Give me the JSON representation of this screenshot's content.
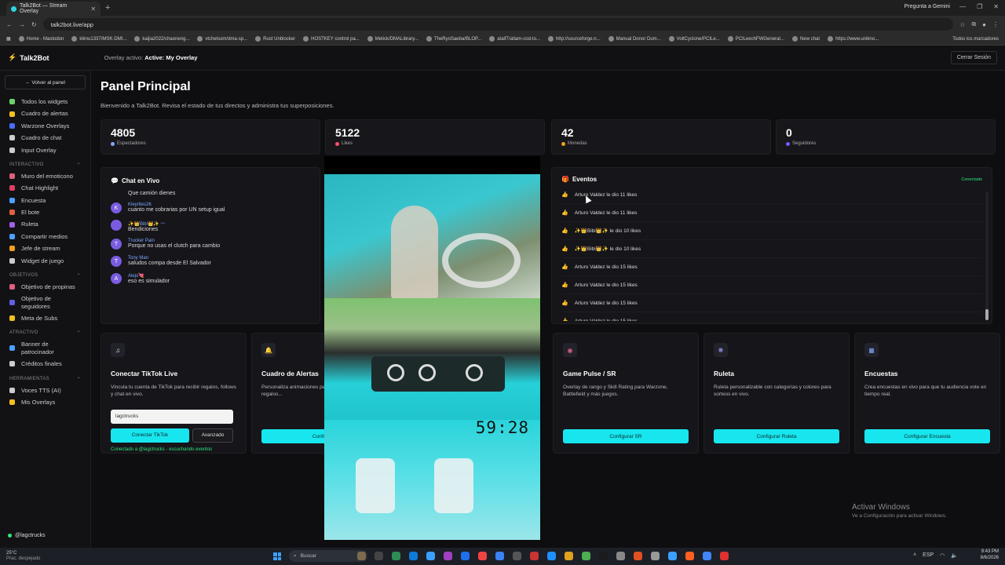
{
  "browser": {
    "tab_title": "Talk2Bot — Stream Overlay",
    "gemini": "Pregunta a Gemini",
    "url": "talk2bot.live/app",
    "bookmarks": [
      "Home - Mastodon",
      "klimu1337/MSK-DMI...",
      "kaijia2022/chaoneng...",
      "vtchelsom/dma-sp...",
      "Rust Unblocker",
      "HOSTKEY control pa...",
      "Metick/DMALibrary...",
      "TheRyoSaeba/BLOP...",
      "ataif7/atlam-cod-to...",
      "http://sourceforge.n...",
      "Manual Donor Dum...",
      "VoltCyclone/PCILe...",
      "PCILeechFWGenerat...",
      "New chat",
      "https://www.unikno..."
    ],
    "bookmarks_all": "Todos los marcadores"
  },
  "header": {
    "logo": "Talk2Bot",
    "overlay_label": "Overlay activo:",
    "overlay_name": "Active: My Overlay",
    "logout": "Cerrar Sesión"
  },
  "sidebar": {
    "back": "← Volver al panel",
    "top_items": [
      {
        "label": "Todos los widgets",
        "color": "#6bd26b"
      },
      {
        "label": "Cuadro de alertas",
        "color": "#f0c020"
      },
      {
        "label": "Warzone Overlays",
        "color": "#4a6cff"
      },
      {
        "label": "Cuadro de chat",
        "color": "#cccccc"
      },
      {
        "label": "Input Overlay",
        "color": "#cccccc"
      }
    ],
    "sections": [
      {
        "title": "INTERACTIVO",
        "items": [
          {
            "label": "Muro del emoticono",
            "color": "#e06080"
          },
          {
            "label": "Chat Highlight",
            "color": "#e04060"
          },
          {
            "label": "Encuesta",
            "color": "#4aa0ff"
          },
          {
            "label": "El bote",
            "color": "#e06040"
          },
          {
            "label": "Ruleta",
            "color": "#a060e0"
          },
          {
            "label": "Compartir medios",
            "color": "#4aa0ff"
          },
          {
            "label": "Jefe de stream",
            "color": "#f0a020"
          },
          {
            "label": "Widget de juego",
            "color": "#cccccc"
          }
        ]
      },
      {
        "title": "OBJETIVOS",
        "items": [
          {
            "label": "Objetivo de propinas",
            "color": "#e06080"
          },
          {
            "label": "Objetivo de seguidores",
            "color": "#6060e0"
          },
          {
            "label": "Meta de Subs",
            "color": "#f0c020"
          }
        ]
      },
      {
        "title": "ATRACTIVO",
        "items": [
          {
            "label": "Banner de patrocinador",
            "color": "#4aa0ff"
          },
          {
            "label": "Créditos finales",
            "color": "#cccccc"
          }
        ]
      },
      {
        "title": "HERRAMIENTAS",
        "items": [
          {
            "label": "Voces TTS (AI)",
            "color": "#cccccc"
          },
          {
            "label": "Mis Overlays",
            "color": "#f0c020"
          }
        ]
      }
    ],
    "user": "@lagctrucks"
  },
  "main": {
    "title": "Panel Principal",
    "subtitle": "Bienvenido a Talk2Bot. Revisa el estado de tus directos y administra tus superposiciones.",
    "stats": [
      {
        "value": "4805",
        "label": "Espectadores",
        "color": "#7fa8ff"
      },
      {
        "value": "5122",
        "label": "Likes",
        "color": "#ff4d6d"
      },
      {
        "value": "42",
        "label": "Monedas",
        "color": "#f0a020"
      },
      {
        "value": "0",
        "label": "Seguidores",
        "color": "#6a5cff"
      }
    ],
    "chat": {
      "title": "Chat en Vivo",
      "messages": [
        {
          "initial": "",
          "name": "",
          "text": "Que camión dienes"
        },
        {
          "initial": "K",
          "name": "Kleyrites26",
          "text": "cuanto me cobrarias por UN setup igual"
        },
        {
          "initial": "",
          "name": "✨👑Bibi👑✨ 〰",
          "text": "Bendiciones"
        },
        {
          "initial": "T",
          "name": "Trucker Pain",
          "text": "Porque no usas el clutch para cambio"
        },
        {
          "initial": "T",
          "name": "Tony Man",
          "text": "saludos compa desde El Salvador"
        },
        {
          "initial": "A",
          "name": "Alejo💘",
          "text": "eso es simulador"
        }
      ]
    },
    "events": {
      "title": "Eventos",
      "status": "Conectado",
      "items": [
        "Arturo Valdez le dio 11 likes",
        "Arturo Valdez le dio 11 likes",
        "✨👑Bibi👑✨ le dio 10 likes",
        "✨👑Bibi👑✨ le dio 10 likes",
        "Arturo Valdez le dio 15 likes",
        "Arturo Valdez le dio 15 likes",
        "Arturo Valdez le dio 15 likes",
        "Arturo Valdez le dio 15 likes"
      ]
    },
    "tiktok": {
      "title": "Conectar TikTok Live",
      "desc": "Vincula tu cuenta de TikTok para recibir regalos, follows y chat en vivo.",
      "input_value": "lagctrucks",
      "connect": "Conectar TikTok",
      "advanced": "Avanzado",
      "status": "Conectado a @lagctrucks - escuchando eventos"
    },
    "cards": [
      {
        "title": "Cuadro de Alertas",
        "desc": "Personaliza animaciones para nuevos seguidores, regalos...",
        "button": "Configurar",
        "icon": "🔔"
      },
      {
        "title": "Game Pulse / SR",
        "desc": "Overlay de rango y Skill Rating para Warzone, Battlefield y más juegos.",
        "button": "Configurar SR",
        "icon": "◉"
      },
      {
        "title": "Ruleta",
        "desc": "Ruleta personalizable con categorías y colores para sorteos en vivo.",
        "button": "Configurar Ruleta",
        "icon": "❋"
      },
      {
        "title": "Encuestas",
        "desc": "Crea encuestas en vivo para que tu audiencia vote en tiempo real.",
        "button": "Configurar Encuesta",
        "icon": "▦"
      }
    ],
    "video_timer": "59:28"
  },
  "windows": {
    "activate_title": "Activar Windows",
    "activate_sub": "Ve a Configuración para activar Windows."
  },
  "taskbar": {
    "weather_temp": "25°C",
    "weather_desc": "Prac. despejado",
    "search": "Buscar",
    "lang": "ESP",
    "time": "9:43 PM",
    "date": "8/6/2026"
  }
}
